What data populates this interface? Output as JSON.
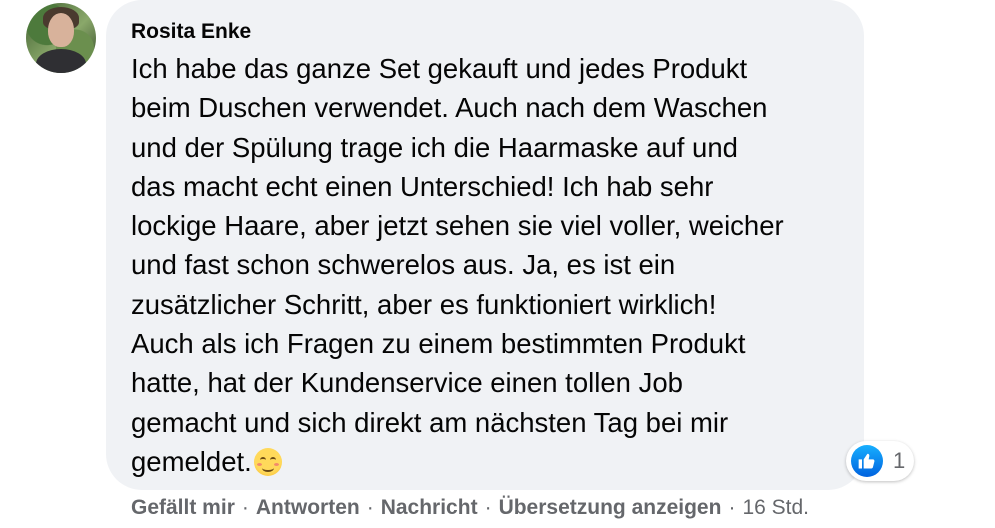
{
  "comment": {
    "author": "Rosita Enke",
    "text_lines": [
      "Ich habe das ganze Set gekauft und jedes Produkt",
      "beim Duschen verwendet. Auch nach dem Waschen",
      "und der Spülung trage ich die Haarmaske auf und",
      "das macht echt einen Unterschied! Ich hab sehr",
      "lockige Haare, aber jetzt sehen sie viel voller, weicher",
      "und fast schon schwerelos aus. Ja, es ist ein",
      "zusätzlicher Schritt, aber es funktioniert wirklich!",
      "Auch als ich Fragen zu einem bestimmten Produkt",
      "hatte, hat der Kundenservice einen tollen Job",
      "gemacht und sich direkt am nächsten Tag bei mir",
      "gemeldet."
    ],
    "trailing_emoji": "smiling-face-with-smiling-eyes-emoji"
  },
  "reactions": {
    "icon": "like-icon",
    "count": "1",
    "color": "#1877f2"
  },
  "actions": {
    "like": "Gefällt mir",
    "reply": "Antworten",
    "message": "Nachricht",
    "translate": "Übersetzung anzeigen",
    "separator": "·",
    "time": "16 Std."
  },
  "colors": {
    "bubble": "#f0f2f5",
    "secondary_text": "#65676b",
    "primary_text": "#050505"
  }
}
